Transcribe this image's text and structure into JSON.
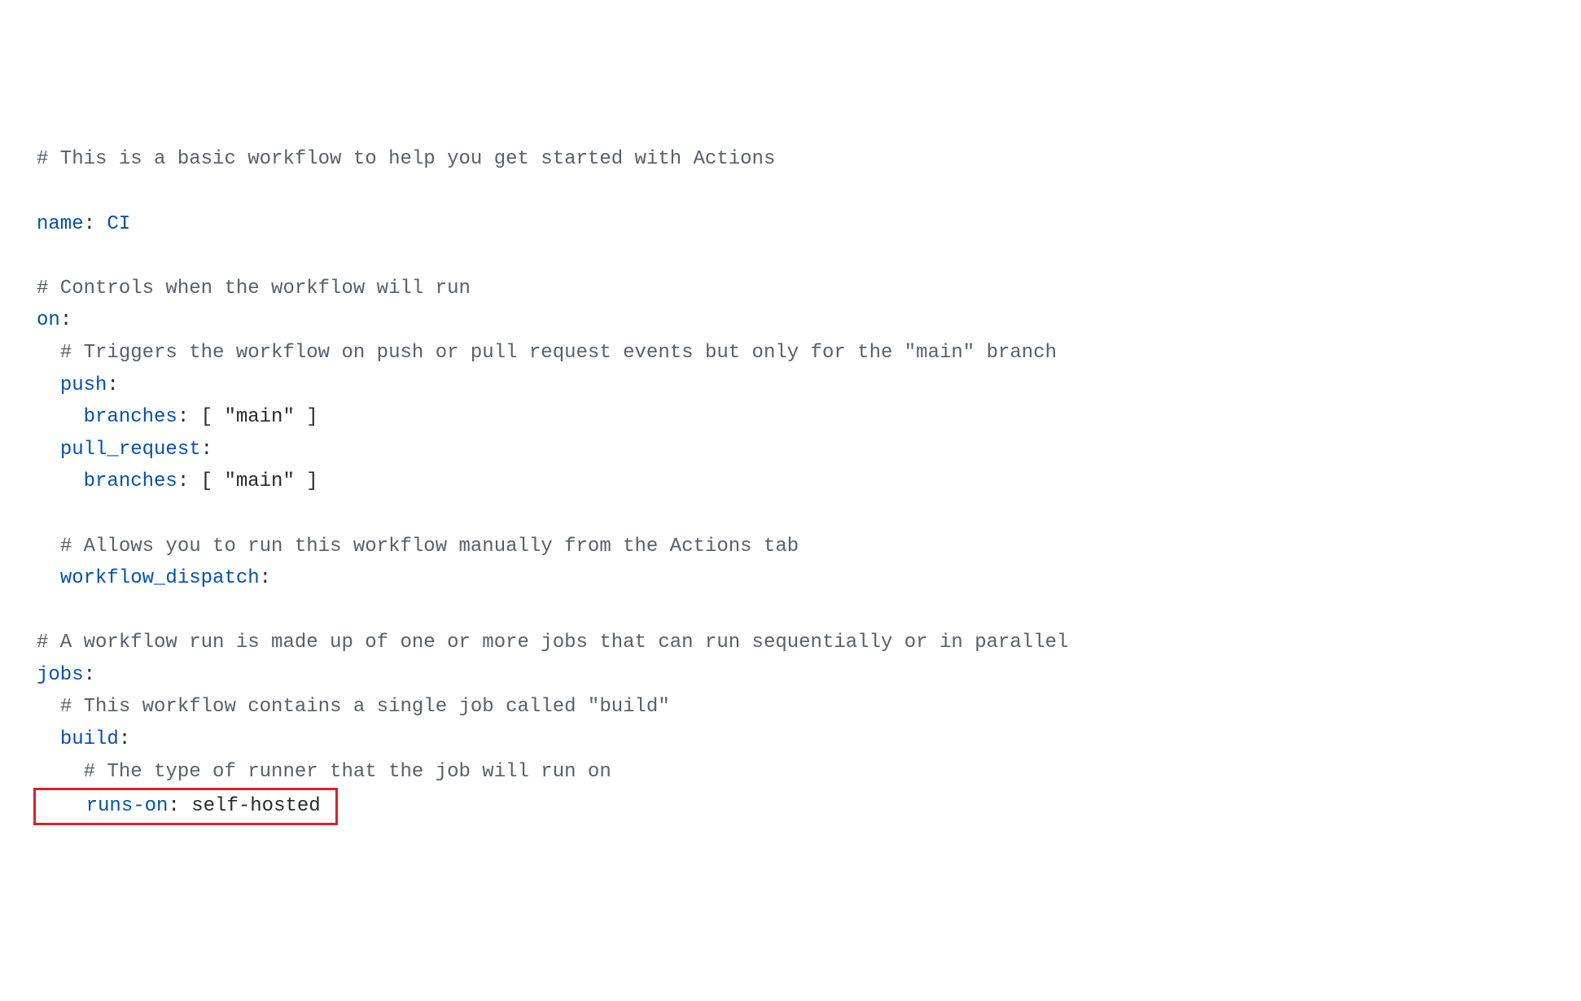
{
  "code": {
    "line1_comment": "# This is a basic workflow to help you get started with Actions",
    "line3_key": "name",
    "line3_value": " CI",
    "line5_comment": "# Controls when the workflow will run",
    "line6_key": "on",
    "line7_comment": "# Triggers the workflow on push or pull request events but only for the \"main\" branch",
    "line8_key": "push",
    "line9_key": "branches",
    "line9_value": " [ \"main\" ]",
    "line10_key": "pull_request",
    "line11_key": "branches",
    "line11_value": " [ \"main\" ]",
    "line13_comment": "# Allows you to run this workflow manually from the Actions tab",
    "line14_key": "workflow_dispatch",
    "line16_comment": "# A workflow run is made up of one or more jobs that can run sequentially or in parallel",
    "line17_key": "jobs",
    "line18_comment": "# This workflow contains a single job called \"build\"",
    "line19_key": "build",
    "line20_comment": "# The type of runner that the job will run on",
    "line21_key": "runs-on",
    "line21_value": " self-hosted"
  }
}
